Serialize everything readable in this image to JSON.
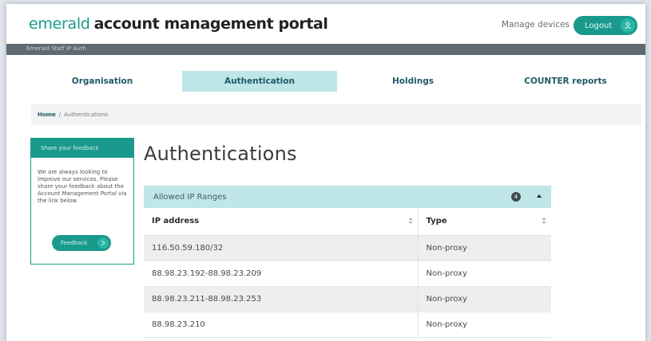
{
  "header": {
    "brand_light": "emerald",
    "brand_bold": "account management portal",
    "manage_devices": "Manage devices",
    "logout_label": "Logout"
  },
  "greybar": {
    "label": "Emerald Staff IP Auth"
  },
  "tabs": [
    {
      "label": "Organisation",
      "active": false
    },
    {
      "label": "Authentication",
      "active": true
    },
    {
      "label": "Holdings",
      "active": false
    },
    {
      "label": "COUNTER reports",
      "active": false
    }
  ],
  "breadcrumb": {
    "home": "Home",
    "separator": "/",
    "current": "Authentications"
  },
  "feedback": {
    "title": "Share your feedback",
    "text": "We are always looking to improve our services. Please share your feedback about the Account Management Portal via the link below.",
    "button_label": "Feedback"
  },
  "main": {
    "title": "Authentications",
    "section_title": "Allowed IP Ranges",
    "count": "4",
    "columns": [
      "IP address",
      "Type"
    ],
    "rows": [
      {
        "ip": "116.50.59.180/32",
        "type": "Non-proxy"
      },
      {
        "ip": "88.98.23.192-88.98.23.209",
        "type": "Non-proxy"
      },
      {
        "ip": "88.98.23.211-88.98.23.253",
        "type": "Non-proxy"
      },
      {
        "ip": "88.98.23.210",
        "type": "Non-proxy"
      }
    ]
  },
  "colors": {
    "brand": "#1a9a8c",
    "active_tab": "#bfe6e9",
    "nav_text": "#1e5a66",
    "grey_bar": "#5d6a72"
  },
  "icons": {
    "logout": "user-icon",
    "feedback": "arrow-right-icon",
    "sort": "sort-icon",
    "collapse": "chevron-up-icon"
  }
}
